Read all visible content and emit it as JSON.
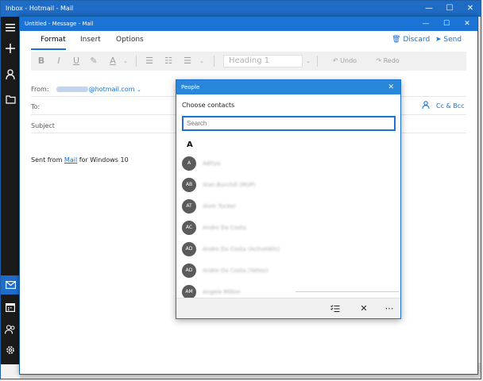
{
  "back_window": {
    "title": "Inbox - Hotmail - Mail",
    "controls": [
      "—",
      "☐",
      "✕"
    ]
  },
  "left_rail": {
    "icons": [
      "hamburger-icon",
      "plus-icon",
      "person-icon",
      "folder-icon",
      "mail-icon",
      "calendar-icon",
      "people-icon",
      "gear-icon"
    ]
  },
  "compose": {
    "title": "Untitled - Message - Mail",
    "controls": [
      "—",
      "☐",
      "✕"
    ],
    "tabs": [
      "Format",
      "Insert",
      "Options"
    ],
    "discard": "Discard",
    "send": "Send",
    "ribbon": {
      "bold": "B",
      "italic": "I",
      "underline": "U",
      "highlight": "✎",
      "font_color": "A",
      "bullets": "☰",
      "numbering": "☷",
      "align": "☰",
      "heading": "Heading 1",
      "undo": "Undo",
      "redo": "Redo"
    },
    "from_label": "From:",
    "from_email": "@hotmail.com",
    "to_label": "To:",
    "subject_label": "Subject",
    "cc_bcc": "Cc & Bcc",
    "body_prefix": "Sent from ",
    "body_link": "Mail",
    "body_suffix": " for Windows 10"
  },
  "people": {
    "title": "People",
    "choose": "Choose contacts",
    "search_placeholder": "Search",
    "letter": "A",
    "contacts": [
      {
        "initials": "A",
        "name": "Aditya"
      },
      {
        "initials": "AB",
        "name": "Alan Burchill (MVP)"
      },
      {
        "initials": "AT",
        "name": "Alvin Tucker"
      },
      {
        "initials": "AC",
        "name": "Andre Da Costa"
      },
      {
        "initials": "AD",
        "name": "Andre Da Costa (ActiveWin)"
      },
      {
        "initials": "AD",
        "name": "Andre Da Costa (Yahoo)"
      },
      {
        "initials": "AM",
        "name": "Angela Milton"
      }
    ]
  },
  "colors": {
    "accent": "#1a73d5",
    "avatar": "#5b5b5b"
  }
}
